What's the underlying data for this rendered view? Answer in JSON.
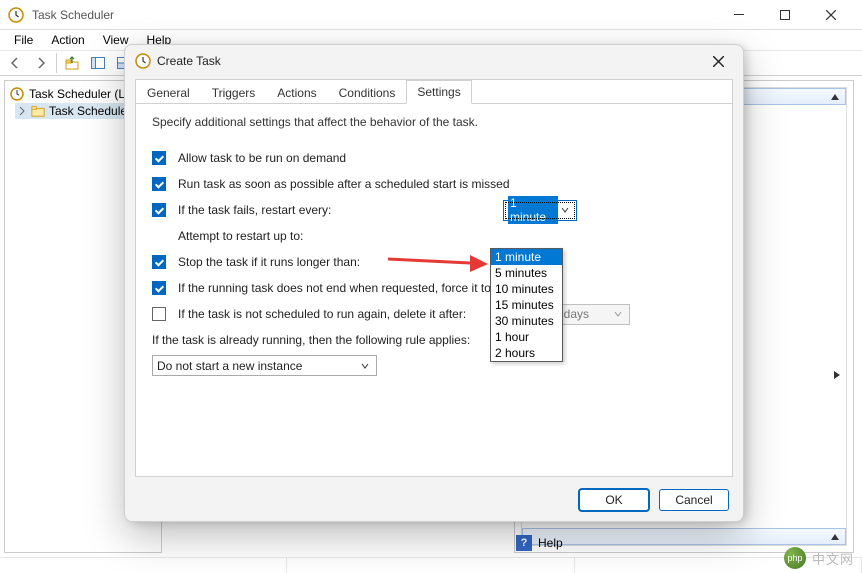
{
  "window": {
    "title": "Task Scheduler",
    "menubar": [
      "File",
      "Action",
      "View",
      "Help"
    ]
  },
  "tree": {
    "root": "Task Scheduler (L",
    "child": "Task Schedule"
  },
  "right_pane": {
    "scroll_hint_up": "",
    "scroll_hint_right": "",
    "scroll_hint_up2": ""
  },
  "help": {
    "label": "Help"
  },
  "dialog": {
    "title": "Create Task",
    "tabs": [
      "General",
      "Triggers",
      "Actions",
      "Conditions",
      "Settings"
    ],
    "selected_tab": 4,
    "settings": {
      "desc": "Specify additional settings that affect the behavior of the task.",
      "allow_demand": "Allow task to be run on demand",
      "run_asap": "Run task as soon as possible after a scheduled start is missed",
      "restart_every": "If the task fails, restart every:",
      "restart_value": "1 minute",
      "restart_options": [
        "1 minute",
        "5 minutes",
        "10 minutes",
        "15 minutes",
        "30 minutes",
        "1 hour",
        "2 hours"
      ],
      "attempts_label": "Attempt to restart up to:",
      "stop_longer": "Stop the task if it runs longer than:",
      "force_stop": "If the running task does not end when requested, force it to sto",
      "delete_after": "If the task is not scheduled to run again, delete it after:",
      "delete_value": "30 days",
      "rule_label": "If the task is already running, then the following rule applies:",
      "rule_value": "Do not start a new instance"
    },
    "buttons": {
      "ok": "OK",
      "cancel": "Cancel"
    }
  },
  "watermark": {
    "logo": "php",
    "text": "中文网"
  }
}
